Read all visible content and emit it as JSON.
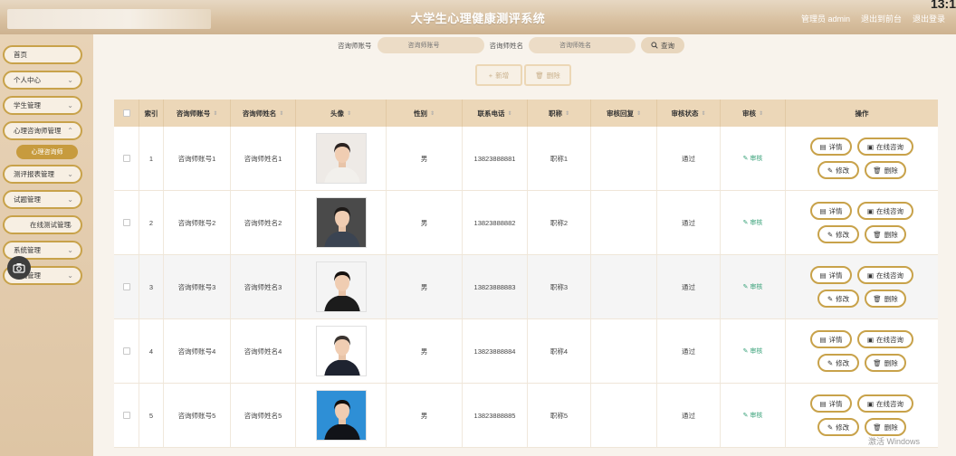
{
  "header": {
    "title": "大学生心理健康测评系统",
    "links": [
      "管理员 admin",
      "退出到前台",
      "退出登录"
    ],
    "clock": "13:1"
  },
  "sidebar": {
    "items": [
      {
        "label": "首页"
      },
      {
        "label": "个人中心"
      },
      {
        "label": "学生管理"
      },
      {
        "label": "心理咨询师管理"
      },
      {
        "label": "测评报表管理"
      },
      {
        "label": "试题管理"
      },
      {
        "label": "在线测试管理"
      },
      {
        "label": "系统管理"
      },
      {
        "label": "考试管理"
      }
    ],
    "active_sub": "心理咨询师"
  },
  "search": {
    "field1_label": "咨询师账号",
    "field1_placeholder": "咨询师账号",
    "field2_label": "咨询师姓名",
    "field2_placeholder": "咨询师姓名",
    "button": "查询"
  },
  "actions": {
    "add": "新增",
    "delete": "删除"
  },
  "table": {
    "columns": [
      "",
      "索引",
      "咨询师账号",
      "咨询师姓名",
      "头像",
      "性别",
      "联系电话",
      "职称",
      "审核回复",
      "审核状态",
      "审核",
      "操作"
    ],
    "rows": [
      {
        "index": "1",
        "account": "咨询师账号1",
        "name": "咨询师姓名1",
        "gender": "男",
        "phone": "13823888881",
        "title": "职称1",
        "reply": "",
        "status": "通过",
        "audit": "审核"
      },
      {
        "index": "2",
        "account": "咨询师账号2",
        "name": "咨询师姓名2",
        "gender": "男",
        "phone": "13823888882",
        "title": "职称2",
        "reply": "",
        "status": "通过",
        "audit": "审核"
      },
      {
        "index": "3",
        "account": "咨询师账号3",
        "name": "咨询师姓名3",
        "gender": "男",
        "phone": "13823888883",
        "title": "职称3",
        "reply": "",
        "status": "通过",
        "audit": "审核"
      },
      {
        "index": "4",
        "account": "咨询师账号4",
        "name": "咨询师姓名4",
        "gender": "男",
        "phone": "13823888884",
        "title": "职称4",
        "reply": "",
        "status": "通过",
        "audit": "审核"
      },
      {
        "index": "5",
        "account": "咨询师账号5",
        "name": "咨询师姓名5",
        "gender": "男",
        "phone": "13823888885",
        "title": "职称5",
        "reply": "",
        "status": "通过",
        "audit": "审核"
      }
    ],
    "op_labels": {
      "detail": "详情",
      "consult": "在线咨询",
      "edit": "修改",
      "delete": "删除"
    }
  },
  "watermark": "激活 Windows",
  "colors": {
    "accent": "#c8a24a",
    "header": "#ecd7b8",
    "audit": "#3aa27a"
  }
}
